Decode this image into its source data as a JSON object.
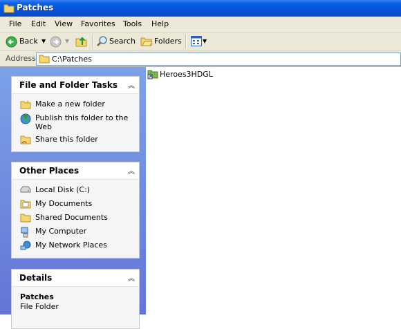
{
  "window": {
    "title": "Patches"
  },
  "menu": [
    "File",
    "Edit",
    "View",
    "Favorites",
    "Tools",
    "Help"
  ],
  "toolbar": {
    "back": "Back",
    "search": "Search",
    "folders": "Folders"
  },
  "address": {
    "label": "Address",
    "path": "C:\\Patches"
  },
  "tasks": {
    "title": "File and Folder Tasks",
    "items": [
      {
        "label": "Make a new folder",
        "icon": "new-folder-icon"
      },
      {
        "label": "Publish this folder to the Web",
        "icon": "publish-web-icon"
      },
      {
        "label": "Share this folder",
        "icon": "share-folder-icon"
      }
    ]
  },
  "places": {
    "title": "Other Places",
    "items": [
      {
        "label": "Local Disk (C:)",
        "icon": "drive-icon"
      },
      {
        "label": "My Documents",
        "icon": "documents-icon"
      },
      {
        "label": "Shared Documents",
        "icon": "shared-folder-icon"
      },
      {
        "label": "My Computer",
        "icon": "computer-icon"
      },
      {
        "label": "My Network Places",
        "icon": "network-icon"
      }
    ]
  },
  "details": {
    "title": "Details",
    "name": "Patches",
    "type": "File Folder"
  },
  "files": [
    {
      "name": "Heroes3HDGL",
      "icon": "shortcut-folder-icon"
    }
  ]
}
